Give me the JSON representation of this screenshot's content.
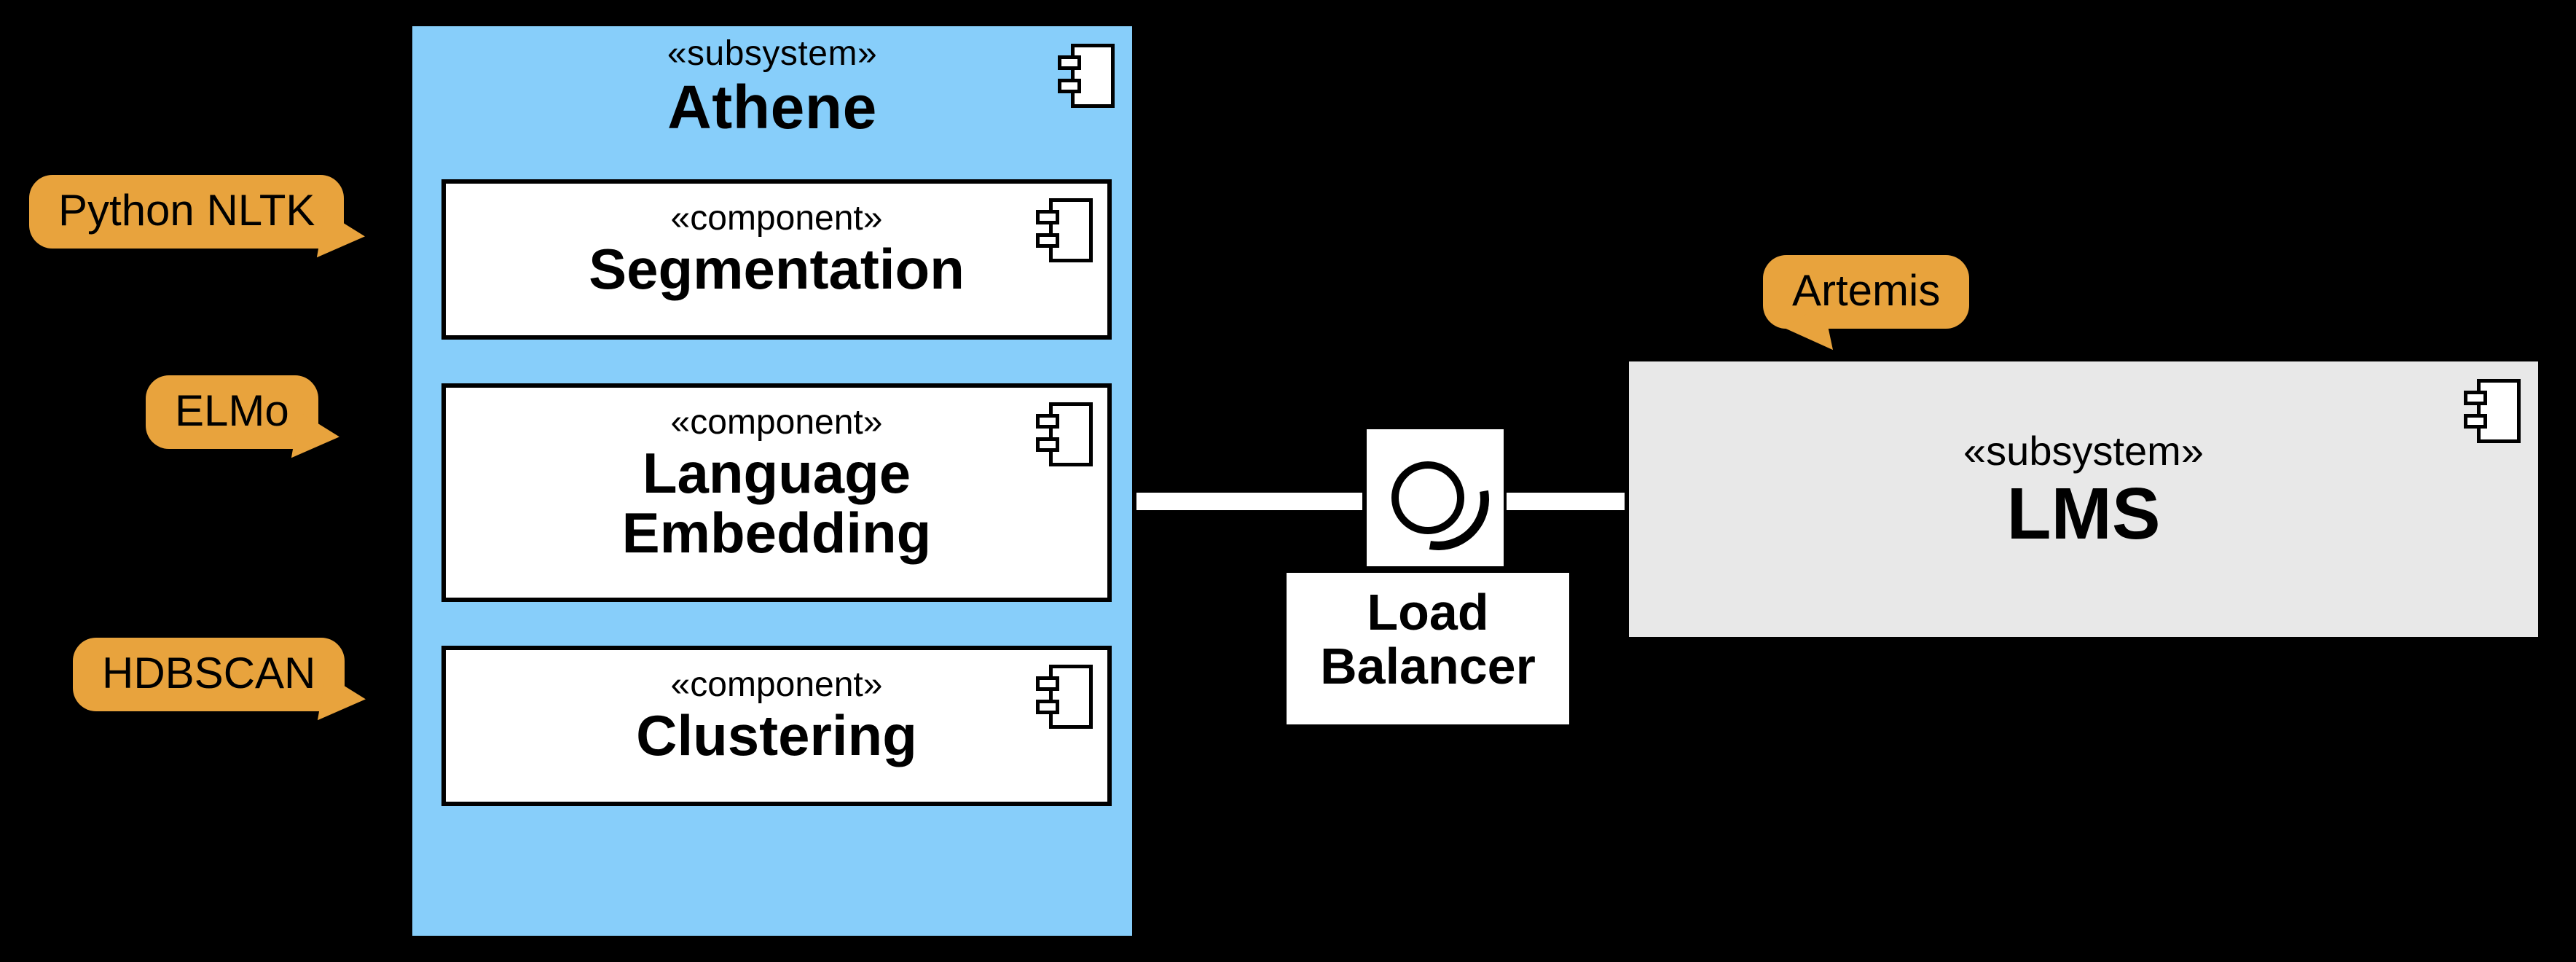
{
  "athene": {
    "stereotype": "«subsystem»",
    "name": "Athene",
    "components": [
      {
        "stereotype": "«component»",
        "name": "Segmentation"
      },
      {
        "stereotype": "«component»",
        "name": "Language\nEmbedding"
      },
      {
        "stereotype": "«component»",
        "name": "Clustering"
      }
    ]
  },
  "lms": {
    "stereotype": "«subsystem»",
    "name": "LMS"
  },
  "load_balancer": {
    "line1": "Load",
    "line2": "Balancer"
  },
  "callouts": {
    "nltk": "Python NLTK",
    "elmo": "ELMo",
    "hdbscan": "HDBSCAN",
    "artemis": "Artemis"
  },
  "chart_data": {
    "type": "diagram",
    "description": "UML component diagram",
    "subsystems": [
      {
        "name": "Athene",
        "components": [
          {
            "name": "Segmentation",
            "annotation": "Python NLTK"
          },
          {
            "name": "Language Embedding",
            "annotation": "ELMo"
          },
          {
            "name": "Clustering",
            "annotation": "HDBSCAN"
          }
        ]
      },
      {
        "name": "LMS",
        "annotation": "Artemis"
      }
    ],
    "connectors": [
      {
        "from": "Athene",
        "to": "Load Balancer",
        "type": "assembly-provided"
      },
      {
        "from": "Load Balancer",
        "to": "LMS",
        "type": "assembly-required"
      }
    ],
    "intermediary": "Load Balancer"
  }
}
